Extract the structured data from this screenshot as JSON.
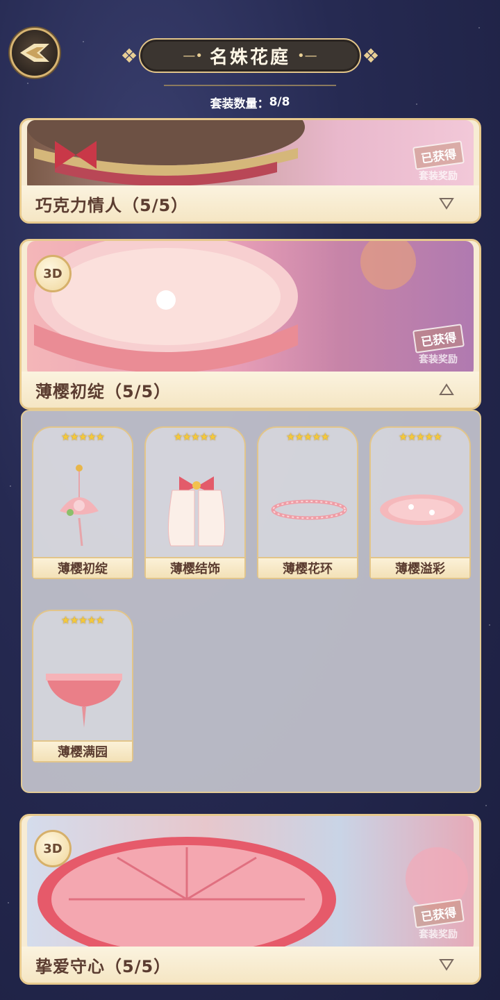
{
  "header": {
    "title": "名姝花庭",
    "count_label": "套装数量：",
    "count_value": "8/8"
  },
  "suits": [
    {
      "name": "巧克力情人（5/5）",
      "status": "已获得",
      "status_sub": "套装奖励",
      "expanded": false,
      "has_3d": false
    },
    {
      "name": "薄樱初绽（5/5）",
      "status": "已获得",
      "status_sub": "套装奖励",
      "expanded": true,
      "has_3d": true,
      "badge": "3D"
    },
    {
      "name": "挚爱守心（5/5）",
      "status": "已获得",
      "status_sub": "套装奖励",
      "expanded": false,
      "has_3d": true,
      "badge": "3D"
    }
  ],
  "items": [
    {
      "name": "薄樱初绽",
      "stars": "★★★★★"
    },
    {
      "name": "薄樱结饰",
      "stars": "★★★★★"
    },
    {
      "name": "薄樱花环",
      "stars": "★★★★★"
    },
    {
      "name": "薄樱溢彩",
      "stars": "★★★★★"
    },
    {
      "name": "薄樱满园",
      "stars": "★★★★★"
    }
  ],
  "colors": {
    "accent_gold": "#e2c58a",
    "text_brown": "#5b3c30",
    "star_gold": "#f5c93a",
    "background_night": "#262a52"
  },
  "icons": {
    "back": "back-arrow-icon",
    "collapse": "triangle-up-icon",
    "expand": "triangle-down-icon"
  }
}
